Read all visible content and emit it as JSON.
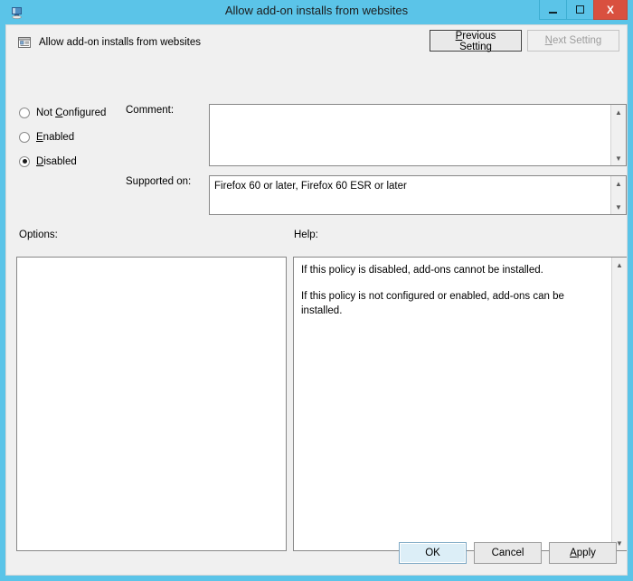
{
  "window": {
    "title": "Allow add-on installs from websites",
    "app_icon": "group-policy-editor-icon",
    "caption": {
      "minimize_label": "–",
      "maximize_label": "□",
      "close_label": "X"
    }
  },
  "header": {
    "policy_icon": "policy-setting-icon",
    "policy_name": "Allow add-on installs from websites",
    "previous_setting_label": "Previous Setting",
    "previous_setting_accel": "P",
    "next_setting_label": "Next Setting",
    "next_setting_accel": "N",
    "next_setting_disabled": true
  },
  "state_options": [
    {
      "id": "not-configured",
      "label": "Not Configured",
      "accel": "C",
      "selected": false
    },
    {
      "id": "enabled",
      "label": "Enabled",
      "accel": "E",
      "selected": false
    },
    {
      "id": "disabled",
      "label": "Disabled",
      "accel": "D",
      "selected": true
    }
  ],
  "fields": {
    "comment_label": "Comment:",
    "comment_value": "",
    "comment_placeholder": "",
    "supported_on_label": "Supported on:",
    "supported_on_value": "Firefox 60 or later, Firefox 60 ESR or later"
  },
  "sections": {
    "options_label": "Options:",
    "options_content": "",
    "help_label": "Help:",
    "help_paragraphs": [
      "If this policy is disabled, add-ons cannot be installed.",
      "If this policy is not configured or enabled, add-ons can be installed."
    ]
  },
  "footer": {
    "ok_label": "OK",
    "cancel_label": "Cancel",
    "apply_label": "Apply",
    "apply_accel": "A"
  },
  "colors": {
    "window_frame": "#5bc4e8",
    "client_background": "#f0f0f0",
    "close_button": "#d9503f",
    "field_background": "#ffffff",
    "default_button_tint": "#dceef7"
  },
  "scroll_icons": {
    "up": "▲",
    "down": "▼"
  }
}
